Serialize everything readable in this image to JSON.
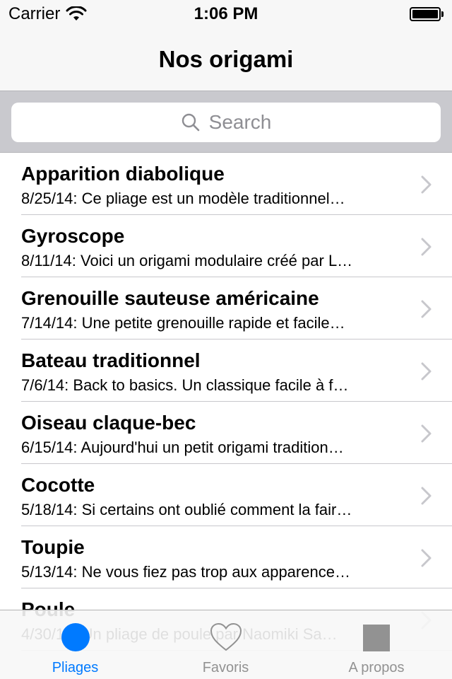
{
  "status_bar": {
    "carrier": "Carrier",
    "time": "1:06 PM",
    "battery_level": 1.0
  },
  "nav": {
    "title": "Nos origami"
  },
  "search": {
    "placeholder": "Search",
    "icon": "search-icon"
  },
  "items": [
    {
      "title": "Apparition diabolique",
      "subtitle": "8/25/14: Ce pliage est un modèle traditionnel…"
    },
    {
      "title": "Gyroscope",
      "subtitle": "8/11/14: Voici un origami modulaire créé par L…"
    },
    {
      "title": "Grenouille sauteuse américaine",
      "subtitle": "7/14/14: Une petite grenouille rapide et facile…"
    },
    {
      "title": "Bateau traditionnel",
      "subtitle": "7/6/14: Back to basics. Un classique facile à f…"
    },
    {
      "title": "Oiseau claque-bec",
      "subtitle": "6/15/14: Aujourd'hui un petit origami tradition…"
    },
    {
      "title": "Cocotte",
      "subtitle": "5/18/14: Si certains ont oublié comment la fair…"
    },
    {
      "title": "Toupie",
      "subtitle": "5/13/14: Ne vous fiez pas trop aux apparence…"
    },
    {
      "title": "Poule",
      "subtitle": "4/30/14: Un pliage de poule par Naomiki Sa…"
    }
  ],
  "tabs": [
    {
      "label": "Pliages",
      "icon": "filled-circle-icon",
      "active": true
    },
    {
      "label": "Favoris",
      "icon": "heart-icon",
      "active": false
    },
    {
      "label": "A propos",
      "icon": "square-icon",
      "active": false
    }
  ],
  "colors": {
    "accent": "#007aff",
    "inactive": "#929292",
    "bar_background": "#f7f7f7",
    "search_background": "#c9c9ce",
    "separator": "#c8c7cc"
  }
}
